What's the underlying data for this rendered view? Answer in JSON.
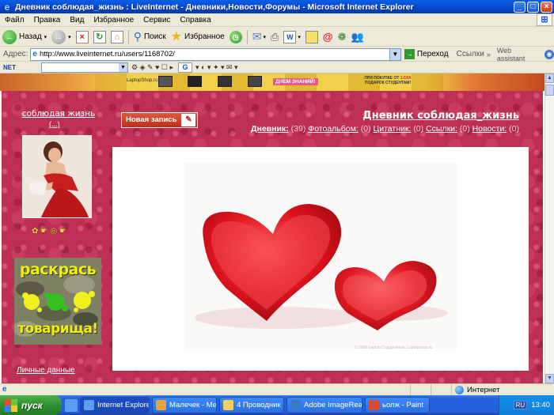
{
  "window": {
    "title": "Дневник соблюдая_жизнь : LiveInternet - Дневники,Новости,Форумы - Microsoft Internet Explorer"
  },
  "menu": {
    "items": [
      "Файл",
      "Правка",
      "Вид",
      "Избранное",
      "Сервис",
      "Справка"
    ]
  },
  "toolbar": {
    "back_label": "Назад",
    "search_label": "Поиск",
    "favorites_label": "Избранное"
  },
  "address_bar": {
    "label": "Адрес:",
    "url": "http://www.liveinternet.ru/users/1168702/",
    "go_label": "Переход",
    "links_label": "Ссылки",
    "assistant_label": "Web assistant"
  },
  "net_toolbar": {
    "brand": "NET"
  },
  "banner": {
    "brand": "LaptopShop.ru",
    "slogan": "ДНЕМ ЗНАНИЙ!",
    "promo_line1": "ПРИ ПОКУПКЕ ОТ",
    "promo_highlight": "1-5ХХ",
    "promo_line2": "ПОДАРОК СТУДЕНТАМ!"
  },
  "sidebar": {
    "user_name": "соблюдая жизнь",
    "user_sub": "(...)",
    "promo_top": "раскрась",
    "promo_bottom": "товарища!",
    "personal_data_link": "Личные данные"
  },
  "header": {
    "new_post_label": "Новая запись",
    "diary_title": "Дневник соблюдая_жизнь",
    "stats": [
      {
        "label": "Дневник:",
        "count": "(39)",
        "lead": true
      },
      {
        "label": "Фотоальбом:",
        "count": "(0)"
      },
      {
        "label": "Цитатник:",
        "count": "(0)"
      },
      {
        "label": "Ссылки:",
        "count": "(0)"
      },
      {
        "label": "Новости:",
        "count": "(0)"
      }
    ]
  },
  "content": {
    "photo_caption": "© 2008 Laptop Подарочные, Laptopshop.ru"
  },
  "status_bar": {
    "zone": "Интернет"
  },
  "taskbar": {
    "start_label": "пуск",
    "tasks": [
      {
        "label": "Internet Explorer",
        "active": true,
        "color": "#5a9ef0"
      },
      {
        "label": "Малечек - Message",
        "active": false,
        "color": "#e8a23a"
      },
      {
        "label": "4 Проводник",
        "active": false,
        "color": "#f0d060"
      },
      {
        "label": "Adobe ImageReady...",
        "active": false,
        "color": "#3a78c8"
      },
      {
        "label": "ьолж - Paint",
        "active": false,
        "color": "#d84a3a"
      }
    ],
    "tray": {
      "lang": "RU",
      "time": "13:40"
    }
  },
  "colors": {
    "page_bg": "#bd2f55",
    "accent_red": "#d8101e"
  }
}
